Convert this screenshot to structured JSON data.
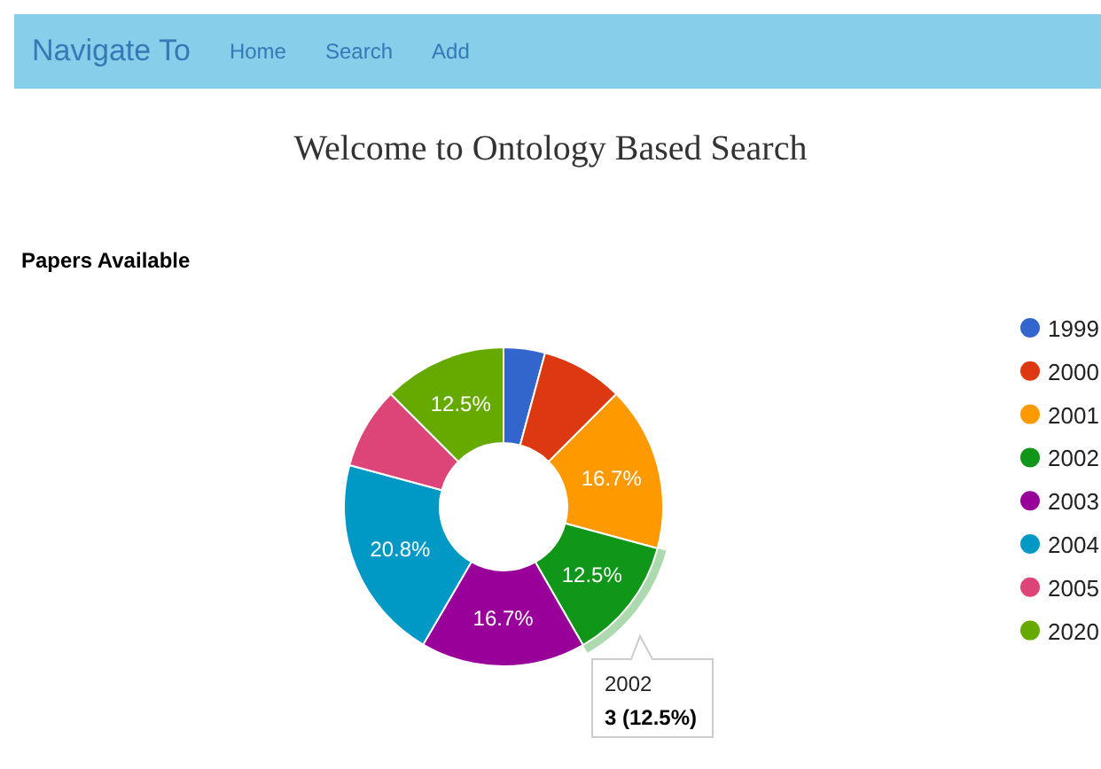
{
  "navbar": {
    "brand": "Navigate To",
    "links": [
      {
        "label": "Home"
      },
      {
        "label": "Search"
      },
      {
        "label": "Add"
      }
    ]
  },
  "heading": "Welcome to Ontology Based Search",
  "papers": {
    "title": "Papers Available",
    "chart_data": {
      "type": "donut",
      "categories": [
        "1999",
        "2000",
        "2001",
        "2002",
        "2003",
        "2004",
        "2005",
        "2020"
      ],
      "series": [
        {
          "values": [
            4.2,
            8.3,
            16.7,
            12.5,
            16.7,
            20.8,
            8.3,
            12.5
          ]
        }
      ],
      "colors": [
        "#3366cc",
        "#dc3912",
        "#ff9900",
        "#109618",
        "#990099",
        "#0099c6",
        "#dd4477",
        "#66aa00"
      ],
      "legend": true,
      "value_labels": [
        null,
        null,
        "16.7%",
        "12.5%",
        "16.7%",
        "20.8%",
        null,
        "12.5%"
      ]
    },
    "slices": [
      {
        "selected": false
      },
      {
        "selected": false
      },
      {
        "selected": false
      },
      {
        "selected": true
      },
      {
        "selected": false
      },
      {
        "selected": false
      },
      {
        "selected": false
      },
      {
        "selected": false
      }
    ],
    "tooltip": {
      "title": "2002",
      "value": "3 (12.5%)"
    }
  }
}
